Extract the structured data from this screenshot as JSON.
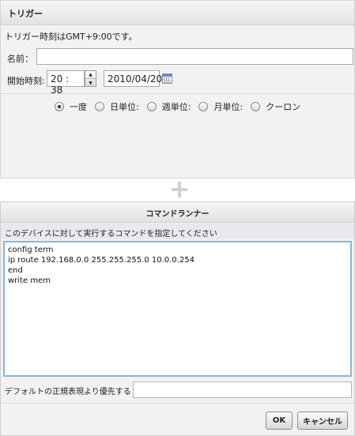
{
  "trigger": {
    "title": "トリガー",
    "timezone_note": "トリガー時刻はGMT+9:00です。",
    "name_label": "名前：",
    "name_value": "",
    "start_label": "開始時刻:",
    "time_value": "20 : 38",
    "date_value": "2010/04/20",
    "recurrence_options": [
      {
        "label": "一度",
        "checked": true
      },
      {
        "label": "日単位:",
        "checked": false
      },
      {
        "label": "週単位:",
        "checked": false
      },
      {
        "label": "月単位:",
        "checked": false
      },
      {
        "label": "クーロン",
        "checked": false
      }
    ]
  },
  "runner": {
    "title": "コマンドランナー",
    "instruction": "このデバイスに対して実行するコマンドを指定してください",
    "commands": "config term\nip route 192.168.0.0 255.255.255.0 10.0.0.254\nend\nwrite mem",
    "regex_label": "デフォルトの正規表現より優先する",
    "regex_value": "",
    "ok_label": "OK",
    "cancel_label": "キャンセル"
  },
  "icons": {
    "spin_up": "triangle-up",
    "spin_down": "triangle-down",
    "calendar": "calendar-icon",
    "connector": "plus-icon"
  }
}
